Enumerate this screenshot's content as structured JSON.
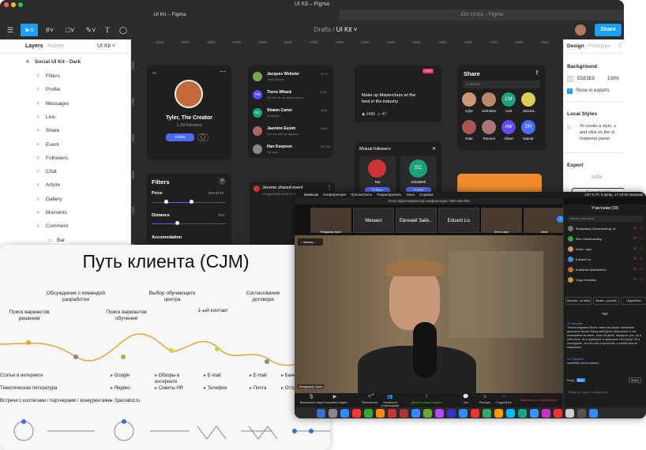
{
  "figma": {
    "window_title": "UI Kit – Figma",
    "tabs": [
      "UI Kit – Figma",
      "iOS UI Kit – Figma"
    ],
    "breadcrumb_drafts": "Drafts",
    "breadcrumb_sep": "/",
    "breadcrumb_file": "UI Kit ˅",
    "share_label": "Share",
    "left_tabs": [
      "Layers",
      "Assets"
    ],
    "page_label": "UI Kit ˅",
    "layers_root": "Social UI Kit - Dark",
    "layers": [
      "Filters",
      "Profile",
      "Messages",
      "Live",
      "Share",
      "Event",
      "Followers",
      "Chat",
      "Article",
      "Gallery",
      "Moments",
      "Comment",
      "Bar"
    ],
    "ruler_ticks": [
      "-3000",
      "-2900",
      "-2800",
      "-2700",
      "-2600",
      "-2500",
      "-2400",
      "-2300",
      "-2200",
      "-2100",
      "-2000",
      "-1900",
      "-1800",
      "-1700",
      "-1600",
      "-1500"
    ],
    "ruler_left": [
      "-3800",
      "-3700",
      "-3600",
      "-3500",
      "-3400",
      "-3300"
    ],
    "right_tabs": [
      "Design",
      "Prototype",
      "C"
    ],
    "background_label": "Background",
    "background_hex": "E5E5E5",
    "background_pct": "100%",
    "show_exports": "Show in exports",
    "local_styles": "Local Styles",
    "local_styles_hint": "To create a style, s and click on the st Inspector panel.",
    "export_label": "Export",
    "suffix_label": "Suffix",
    "export_button": "Export UI K",
    "colors": {
      "accent": "#18a0fb",
      "canvas": "#2a2a2a",
      "card": "#1f1f1f",
      "blue": "#4b6bfb"
    }
  },
  "canvas": {
    "profile_name": "Tyler, The Creator",
    "profile_followers": "1.2M followers",
    "profile_follow": "Follow",
    "messages": [
      {
        "name": "Jacques Webster",
        "text": "Yeah I know",
        "time": "11:47",
        "initials": "",
        "color": "#7a5"
      },
      {
        "name": "Tierra Whack",
        "text": "So tell me up when you're...",
        "time": "8:30",
        "initials": "TW",
        "color": "#5b4cf0"
      },
      {
        "name": "Shawn Carter",
        "text": "Is typing...",
        "time": "Wed",
        "initials": "SC",
        "color": "#1aa37a"
      },
      {
        "name": "Jasmine Essim",
        "text": "Let me call my agency",
        "time": "Mon",
        "initials": "",
        "color": "#a66"
      },
      {
        "name": "Han Keepson",
        "text": "I'm sure",
        "time": "28 Feb",
        "initials": "",
        "color": "#888"
      }
    ],
    "live_badge": "LIVE",
    "live_title": "Make up Masterclass w/ the best in the industry",
    "live_views": "2488",
    "live_comments": "47",
    "share_title": "Share",
    "share_search": "Search",
    "share_people": [
      {
        "name": "Kylie",
        "initials": "",
        "color": "#c97"
      },
      {
        "name": "Johnston",
        "initials": "",
        "color": "#b86"
      },
      {
        "name": "Carl",
        "initials": "CM",
        "color": "#1aa37a"
      },
      {
        "name": "Jessica",
        "initials": "",
        "color": "#dc5"
      },
      {
        "name": "Kate",
        "initials": "",
        "color": "#a55"
      },
      {
        "name": "Tomomi",
        "initials": "",
        "color": "#a77"
      },
      {
        "name": "Albert",
        "initials": "AW",
        "color": "#5b4cf0"
      },
      {
        "name": "Damar",
        "initials": "DR",
        "color": "#4b6bfb"
      }
    ],
    "mutual_title": "Mutual followers",
    "mutual_people": [
      {
        "name": "Nia",
        "initials": "",
        "color": "#c33"
      },
      {
        "name": "Elizabeth",
        "initials": "EC",
        "color": "#1aa37a"
      }
    ],
    "follow": "Follow",
    "filters_title": "Filters",
    "price_label": "Price",
    "price_range": "$50-$125",
    "distance_label": "Distance",
    "distance_value": "7km",
    "accommodation_label": "Accomodation",
    "event_title": "Jerome shared event",
    "event_date": "12 April 2019 at 10:47 AM",
    "event_day": "21",
    "event_month": "May"
  },
  "cjm": {
    "title": "Путь клиента (CJM)",
    "stages": [
      {
        "label": "Поиск вариантов решения"
      },
      {
        "label": "Обсуждение с командой разработки"
      },
      {
        "label": "Поиск вариантов обучения"
      },
      {
        "label": "Выбор обучающего центра"
      },
      {
        "label": "1-ый контакт"
      },
      {
        "label": "Согласование договора"
      }
    ],
    "col1": [
      "Статьи в интернете",
      "Тематическая литература",
      "Встречи с коллегами / партнерами / конкурентами"
    ],
    "col2": [
      "Google",
      "Яндекс",
      "Specialist.ru"
    ],
    "col3": [
      "Обзоры в интернете",
      "Советы HR"
    ],
    "col4": [
      "E-mail",
      "Телефон"
    ],
    "col5": [
      "E-mail",
      "Почта"
    ],
    "col6": [
      "Банк",
      "Отпр по по"
    ],
    "mood_colors": [
      "#e8a43a",
      "#8cc63f",
      "#c6d93a",
      "#c6d93a"
    ]
  },
  "zoom": {
    "menu": [
      "zoom.us",
      "Конференция",
      "Просмотреть",
      "Редактировать",
      "Окно",
      "Справка"
    ],
    "status_right": "100 %  Пт 9 февр. 17:18:00  Maxмим",
    "window_title": "Zoom Идентификатор конференции: 959-284-060",
    "thumbs": [
      "Владимир Арин",
      "Михаил",
      "Евгений Зайк...",
      "Eduard Lis",
      "Антон Laps",
      "Zaxar"
    ],
    "recording": "Запись...",
    "speaker_name": "Владимир Арин",
    "participants_title": "Участники (10)",
    "participants_search": "Найти участника",
    "participants": [
      {
        "name": "Владимир  (Организатор, я)",
        "color": "#777"
      },
      {
        "name": "Alex Olshanowsky",
        "color": "#3a3"
      },
      {
        "name": "Anton Laps",
        "color": "#c96"
      },
      {
        "name": "Eduard Lis",
        "color": "#39c"
      },
      {
        "name": "Kulbarish Adambekov",
        "color": "#c63"
      },
      {
        "name": "Sega Hamilton",
        "color": "#c93"
      }
    ],
    "participant_actions": [
      "Выключ...ук всем",
      "Включ...ук всем",
      "Подробнее"
    ],
    "chat_title": "Чат",
    "chat_from": "От Михаил",
    "chat_text": "Только недавно была такая ситуация, компания довольно была, перед выбором обратилась к так понимание за свою, тоже на дней, передтэт усе, но я небольно, из в принципе в принципе того могут 20 а последние, что это как я прошлом, и зачем чем не понимаем.",
    "chat_from2": "От Первый",
    "chat_text2": "понаблю очень сильно",
    "chat_to": "Кому:",
    "chat_to_value": "Все",
    "chat_file": "Файл",
    "chat_placeholder": "Введите здесь сообщение...",
    "controls": [
      "Выключить звук",
      "Остановить видео",
      "Пригласить",
      "Управлять участниками",
      "Демонстрация экрана",
      "Чат",
      "Реакции",
      "Подробнее"
    ],
    "participants_count": "10",
    "end_label": "Завершить конференцию"
  }
}
